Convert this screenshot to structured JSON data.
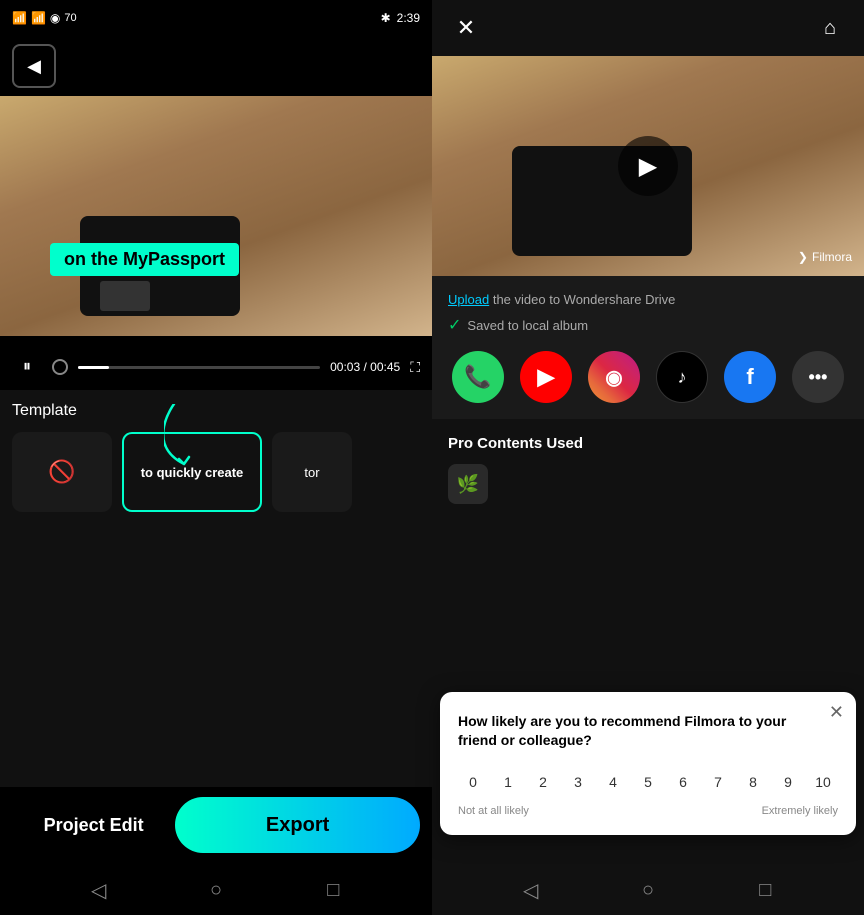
{
  "statusBar": {
    "signal1": "4G",
    "signal2": "4G",
    "wifi": "wifi",
    "bluetooth": "BT",
    "battery": "70",
    "time": "2:39"
  },
  "leftPanel": {
    "backBtn": "◀",
    "videoCaption": "on the MyPassport",
    "timeline": {
      "currentTime": "00:03",
      "totalTime": "00:45",
      "progressPct": 13
    },
    "template": {
      "label": "Template",
      "items": [
        {
          "id": "empty",
          "label": ""
        },
        {
          "id": "selected",
          "label": "to quickly create"
        },
        {
          "id": "partial",
          "label": "tor"
        }
      ]
    },
    "projectEditLabel": "Project Edit",
    "exportLabel": "Export"
  },
  "rightPanel": {
    "uploadText": "Upload",
    "uploadRest": " the video to Wondershare Drive",
    "savedText": "Saved to local album",
    "socialApps": [
      {
        "name": "WhatsApp",
        "icon": "W"
      },
      {
        "name": "YouTube",
        "icon": "▶"
      },
      {
        "name": "Instagram",
        "icon": "📷"
      },
      {
        "name": "TikTok",
        "icon": "♪"
      },
      {
        "name": "Facebook",
        "icon": "f"
      },
      {
        "name": "More",
        "icon": "..."
      }
    ],
    "proContents": {
      "title": "Pro Contents Used"
    },
    "survey": {
      "question": "How likely are you to recommend Filmora to your friend or colleague?",
      "numbers": [
        "0",
        "1",
        "2",
        "3",
        "4",
        "5",
        "6",
        "7",
        "8",
        "9",
        "10"
      ],
      "labelLeft": "Not at all likely",
      "labelRight": "Extremely likely"
    },
    "filmora": "Filmora"
  }
}
